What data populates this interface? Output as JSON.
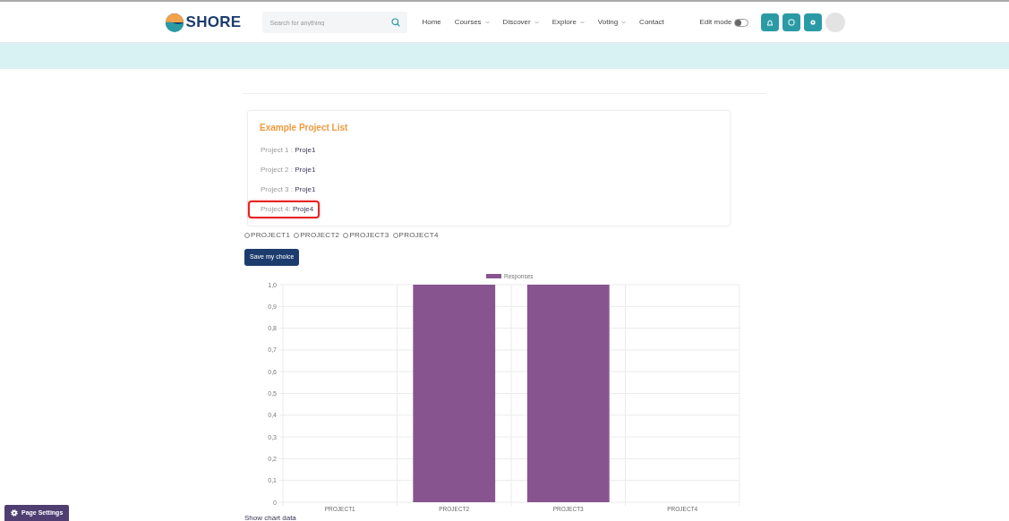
{
  "brand": {
    "name": "SHORE"
  },
  "search": {
    "placeholder": "Search for anything"
  },
  "nav": [
    {
      "label": "Home",
      "dropdown": false
    },
    {
      "label": "Courses",
      "dropdown": true
    },
    {
      "label": "Discover",
      "dropdown": true
    },
    {
      "label": "Explore",
      "dropdown": true
    },
    {
      "label": "Voting",
      "dropdown": true
    },
    {
      "label": "Contact",
      "dropdown": false
    }
  ],
  "edit_mode": {
    "label": "Edit mode",
    "on": false
  },
  "project_list": {
    "title": "Example Project List",
    "items": [
      {
        "label": "Project 1 :",
        "value": "Proje1",
        "highlighted": false
      },
      {
        "label": "Project 2 :",
        "value": "Proje1",
        "highlighted": false
      },
      {
        "label": "Project 3 :",
        "value": "Proje1",
        "highlighted": false
      },
      {
        "label": "Project 4:",
        "value": "Proje4",
        "highlighted": true
      }
    ]
  },
  "choices": [
    {
      "label": "PROJECT1",
      "selected": false
    },
    {
      "label": "PROJECT2",
      "selected": false
    },
    {
      "label": "PROJECT3",
      "selected": false
    },
    {
      "label": "PROJECT4",
      "selected": false
    }
  ],
  "save_button": "Save my choice",
  "chart": {
    "chart_data": {
      "type": "bar",
      "categories": [
        "PROJECT1",
        "PROJECT2",
        "PROJECT3",
        "PROJECT4"
      ],
      "series": [
        {
          "name": "Responses",
          "color": "#88548f",
          "values": [
            0,
            1,
            1,
            0
          ]
        }
      ],
      "ylim": [
        0,
        1
      ],
      "grid": true,
      "yticks": [
        {
          "value": 0,
          "label": "0"
        },
        {
          "value": 0.1,
          "label": "0,1"
        },
        {
          "value": 0.2,
          "label": "0,2"
        },
        {
          "value": 0.3,
          "label": "0,3"
        },
        {
          "value": 0.4,
          "label": "0,4"
        },
        {
          "value": 0.5,
          "label": "0,5"
        },
        {
          "value": 0.6,
          "label": "0,6"
        },
        {
          "value": 0.7,
          "label": "0,7"
        },
        {
          "value": 0.8,
          "label": "0,8"
        },
        {
          "value": 0.9,
          "label": "0,9"
        },
        {
          "value": 1,
          "label": "1,0"
        }
      ]
    }
  },
  "show_chart_data": "Show chart data",
  "page_settings": "Page Settings"
}
